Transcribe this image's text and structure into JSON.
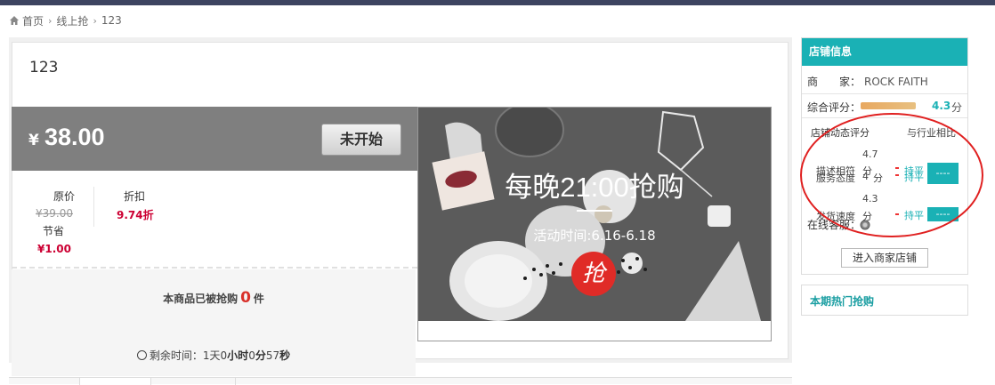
{
  "breadcrumb": {
    "home": "首页",
    "level1": "线上抢",
    "current": "123"
  },
  "product": {
    "title": "123",
    "currency_symbol": "¥",
    "price": "38.00",
    "status_button": "未开始",
    "original_price_label": "原价",
    "original_price": "¥39.00",
    "discount_label": "折扣",
    "discount": "9.74折",
    "save_label": "节省",
    "save_value": "¥1.00",
    "sold_prefix": "本商品已被抢购",
    "sold_count": "0",
    "sold_suffix": "件",
    "countdown_prefix": "剩余时间：",
    "countdown_days": "1",
    "countdown_days_unit": "天",
    "countdown_hours": "0",
    "countdown_hours_unit": "小时",
    "countdown_minutes": "0",
    "countdown_minutes_unit": "分",
    "countdown_seconds": "57",
    "countdown_seconds_unit": "秒"
  },
  "banner": {
    "title": "每晚21:00抢购",
    "subtitle": "活动时间:6.16-6.18",
    "badge": "抢"
  },
  "store": {
    "header": "店铺信息",
    "merchant_label": "商　　家：",
    "merchant_value": "ROCK FAITH",
    "rating_label": "综合评分：",
    "rating_value": "4.3",
    "rating_unit": "分",
    "rating_fraction": 0.86,
    "dynamic_label": "店铺动态评分",
    "compare_label": "与行业相比",
    "rows": [
      {
        "score": "4.7",
        "label_a": "描述相符",
        "label_b": "服务态度",
        "score_b": "4",
        "unit": "分",
        "flat_a": "持平",
        "flat_b": "持平",
        "box": "----"
      },
      {
        "score": "4.3",
        "label_a": "发货速度",
        "unit": "分",
        "flat_a": "持平",
        "box": "----"
      }
    ],
    "online_cs": "在线客服：",
    "enter_button": "进入商家店铺"
  },
  "hot": {
    "header": "本期热门抢购"
  },
  "colors": {
    "accent": "#1ab1b5",
    "price_bar": "#7f7f7f",
    "red": "#e02b27",
    "topbar": "#3d4460"
  }
}
